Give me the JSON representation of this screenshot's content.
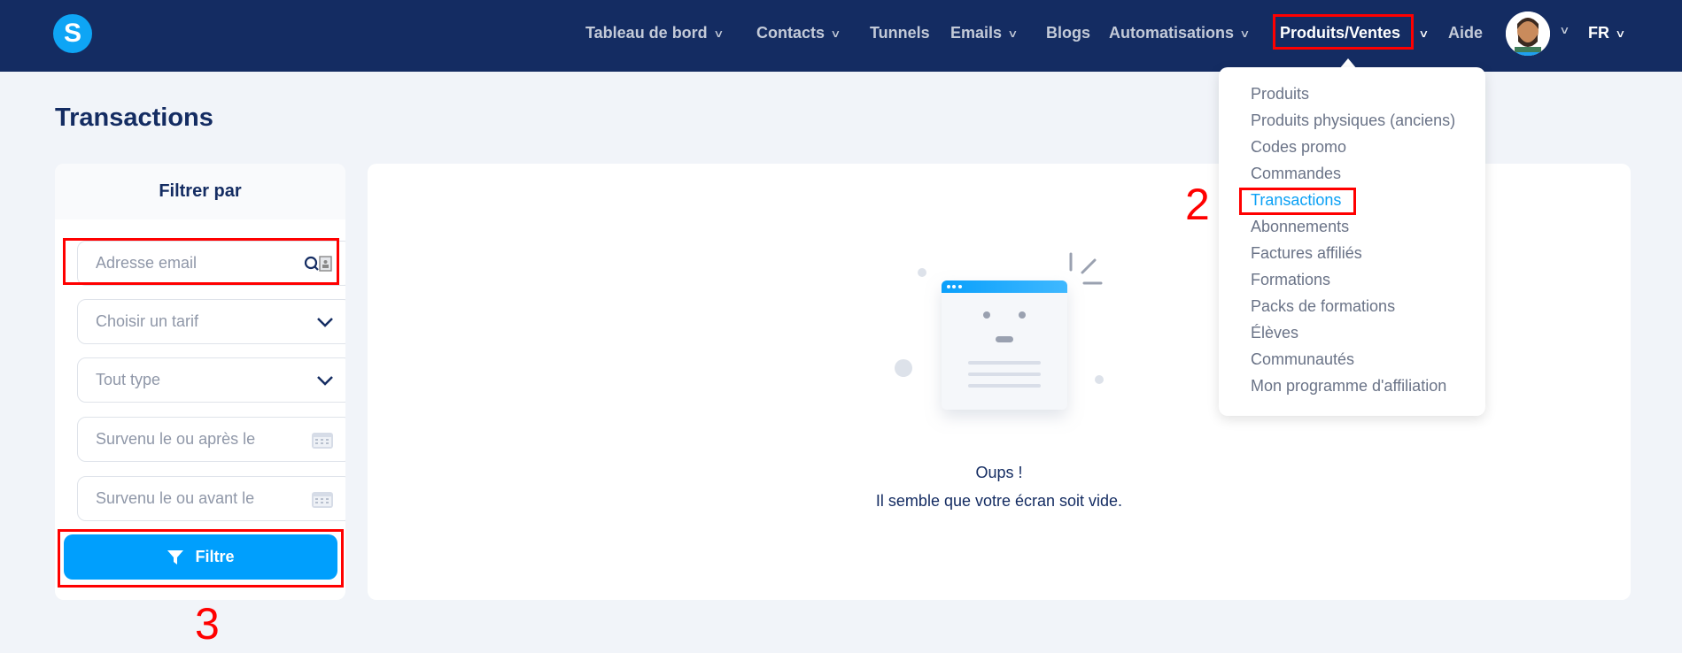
{
  "header": {
    "logo": "S",
    "nav": [
      {
        "label": "Tableau de bord",
        "chevron": true
      },
      {
        "label": "Contacts",
        "chevron": true
      },
      {
        "label": "Tunnels",
        "chevron": false
      },
      {
        "label": "Emails",
        "chevron": true
      },
      {
        "label": "Blogs",
        "chevron": false
      },
      {
        "label": "Automatisations",
        "chevron": true
      },
      {
        "label": "Produits/Ventes",
        "chevron": true
      },
      {
        "label": "Aide",
        "chevron": false
      }
    ],
    "language": "FR"
  },
  "page": {
    "title": "Transactions"
  },
  "filter": {
    "heading": "Filtrer par",
    "email_placeholder": "Adresse email",
    "tarif_placeholder": "Choisir un tarif",
    "type_placeholder": "Tout type",
    "after_placeholder": "Survenu le ou après le",
    "before_placeholder": "Survenu le ou avant le",
    "button": "Filtre"
  },
  "empty": {
    "line1": "Oups !",
    "line2": "Il semble que votre écran soit vide."
  },
  "dropdown": {
    "items": [
      "Produits",
      "Produits physiques (anciens)",
      "Codes promo",
      "Commandes",
      "Transactions",
      "Abonnements",
      "Factures affiliés",
      "Formations",
      "Packs de formations",
      "Élèves",
      "Communautés",
      "Mon programme d'affiliation"
    ],
    "active_index": 4
  },
  "annotations": {
    "step2": "2",
    "step3": "3"
  },
  "colors": {
    "header": "#142c62",
    "accent": "#009ffd",
    "annotation": "#ff0000"
  }
}
